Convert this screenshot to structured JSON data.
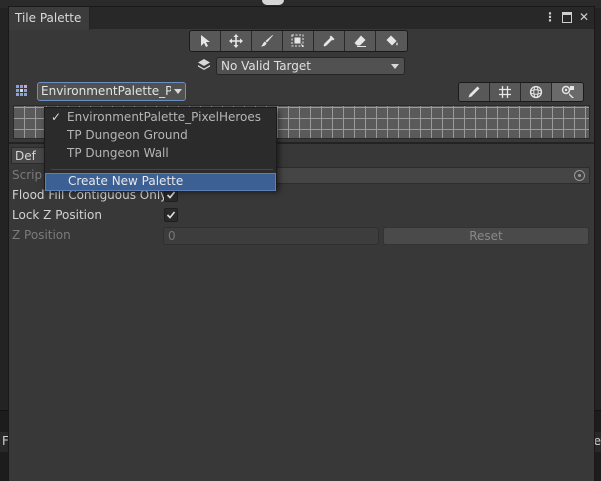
{
  "window": {
    "tab_title": "Tile Palette"
  },
  "toolbar": {
    "tools": [
      "select-icon",
      "move-icon",
      "brush-icon",
      "box-fill-icon",
      "picker-icon",
      "eraser-icon",
      "fill-icon"
    ]
  },
  "active_target": {
    "value": "No Valid Target"
  },
  "palette_dropdown": {
    "value": "EnvironmentPalette_PixelHeroes"
  },
  "palette_menu": {
    "items": [
      {
        "label": "EnvironmentPalette_PixelHeroes",
        "checked": "✓"
      },
      {
        "label": "TP Dungeon Ground",
        "checked": ""
      },
      {
        "label": "TP Dungeon Wall",
        "checked": ""
      }
    ],
    "create_label": "Create New Palette"
  },
  "brush_section": {
    "default_label": "Def",
    "script_label": "Scrip"
  },
  "properties": {
    "flood_fill_label": "Flood Fill Contiguous Only",
    "flood_fill_checked": true,
    "lock_z_label": "Lock Z Position",
    "lock_z_checked": true,
    "z_position_label": "Z Position",
    "z_position_value": "0",
    "reset_label": "Reset"
  },
  "background": {
    "left_text": "F",
    "right_text": "me"
  },
  "colors": {
    "accent_highlight": "#3c5f94",
    "panel_bg": "#383838"
  }
}
